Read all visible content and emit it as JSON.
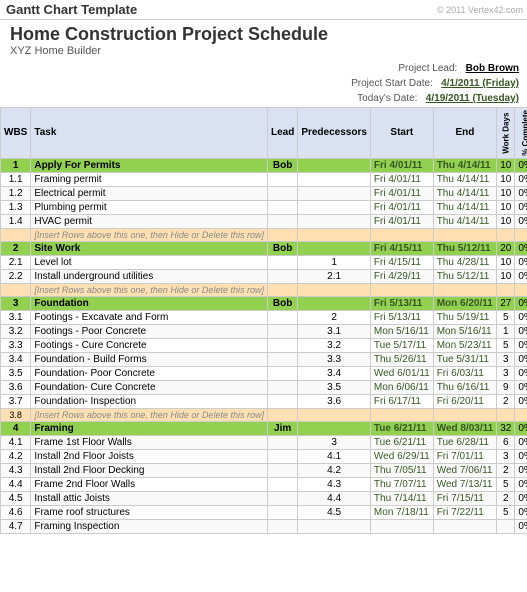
{
  "app": {
    "title": "Gantt Chart Template",
    "copyright": "© 2011 Vertex42.com",
    "project_title": "Home Construction Project Schedule",
    "subtitle": "XYZ Home Builder"
  },
  "project_info": {
    "lead_label": "Project Lead:",
    "lead_value": "Bob Brown",
    "start_label": "Project Start Date:",
    "start_value": "4/1/2011 (Friday)",
    "today_label": "Today's Date:",
    "today_value": "4/19/2011 (Tuesday)"
  },
  "table": {
    "headers": [
      "WBS",
      "Task",
      "Lead",
      "Predecessors",
      "Start",
      "End",
      "Work Days",
      "% Complete"
    ],
    "rows": [
      {
        "type": "section",
        "wbs": "1",
        "task": "Apply For Permits",
        "lead": "Bob",
        "pred": "",
        "start": "Fri 4/01/11",
        "end": "Thu 4/14/11",
        "wd": "10",
        "pct": "0%"
      },
      {
        "type": "normal",
        "wbs": "1.1",
        "task": "Framing permit",
        "lead": "",
        "pred": "",
        "start": "Fri 4/01/11",
        "end": "Thu 4/14/11",
        "wd": "10",
        "pct": "0%"
      },
      {
        "type": "normal",
        "wbs": "1.2",
        "task": "Electrical permit",
        "lead": "",
        "pred": "",
        "start": "Fri 4/01/11",
        "end": "Thu 4/14/11",
        "wd": "10",
        "pct": "0%"
      },
      {
        "type": "normal",
        "wbs": "1.3",
        "task": "Plumbing permit",
        "lead": "",
        "pred": "",
        "start": "Fri 4/01/11",
        "end": "Thu 4/14/11",
        "wd": "10",
        "pct": "0%"
      },
      {
        "type": "normal",
        "wbs": "1.4",
        "task": "HVAC permit",
        "lead": "",
        "pred": "",
        "start": "Fri 4/01/11",
        "end": "Thu 4/14/11",
        "wd": "10",
        "pct": "0%"
      },
      {
        "type": "insert",
        "wbs": "",
        "task": "[Insert Rows above this one, then Hide or Delete this row]",
        "lead": "",
        "pred": "",
        "start": "",
        "end": "",
        "wd": "",
        "pct": ""
      },
      {
        "type": "section",
        "wbs": "2",
        "task": "Site Work",
        "lead": "Bob",
        "pred": "",
        "start": "Fri 4/15/11",
        "end": "Thu 5/12/11",
        "wd": "20",
        "pct": "0%"
      },
      {
        "type": "normal",
        "wbs": "2.1",
        "task": "Level lot",
        "lead": "",
        "pred": "1",
        "start": "Fri 4/15/11",
        "end": "Thu 4/28/11",
        "wd": "10",
        "pct": "0%"
      },
      {
        "type": "normal",
        "wbs": "2.2",
        "task": "Install underground utilities",
        "lead": "",
        "pred": "2.1",
        "start": "Fri 4/29/11",
        "end": "Thu 5/12/11",
        "wd": "10",
        "pct": "0%"
      },
      {
        "type": "insert",
        "wbs": "",
        "task": "[Insert Rows above this one, then Hide or Delete this row]",
        "lead": "",
        "pred": "",
        "start": "",
        "end": "",
        "wd": "",
        "pct": ""
      },
      {
        "type": "section",
        "wbs": "3",
        "task": "Foundation",
        "lead": "Bob",
        "pred": "",
        "start": "Fri 5/13/11",
        "end": "Mon 6/20/11",
        "wd": "27",
        "pct": "0%"
      },
      {
        "type": "normal",
        "wbs": "3.1",
        "task": "Footings - Excavate and Form",
        "lead": "",
        "pred": "2",
        "start": "Fri 5/13/11",
        "end": "Thu 5/19/11",
        "wd": "5",
        "pct": "0%"
      },
      {
        "type": "normal",
        "wbs": "3.2",
        "task": "Footings - Poor Concrete",
        "lead": "",
        "pred": "3.1",
        "start": "Mon 5/16/11",
        "end": "Mon 5/16/11",
        "wd": "1",
        "pct": "0%"
      },
      {
        "type": "normal",
        "wbs": "3.3",
        "task": "Footings - Cure Concrete",
        "lead": "",
        "pred": "3.2",
        "start": "Tue 5/17/11",
        "end": "Mon 5/23/11",
        "wd": "5",
        "pct": "0%"
      },
      {
        "type": "normal",
        "wbs": "3.4",
        "task": "Foundation - Build Forms",
        "lead": "",
        "pred": "3.3",
        "start": "Thu 5/26/11",
        "end": "Tue 5/31/11",
        "wd": "3",
        "pct": "0%"
      },
      {
        "type": "normal",
        "wbs": "3.5",
        "task": "Foundation- Poor Concrete",
        "lead": "",
        "pred": "3.4",
        "start": "Wed 6/01/11",
        "end": "Fri 6/03/11",
        "wd": "3",
        "pct": "0%"
      },
      {
        "type": "normal",
        "wbs": "3.6",
        "task": "Foundation- Cure Concrete",
        "lead": "",
        "pred": "3.5",
        "start": "Mon 6/06/11",
        "end": "Thu 6/16/11",
        "wd": "9",
        "pct": "0%"
      },
      {
        "type": "normal",
        "wbs": "3.7",
        "task": "Foundation- Inspection",
        "lead": "",
        "pred": "3.6",
        "start": "Fri 6/17/11",
        "end": "Fri 6/20/11",
        "wd": "2",
        "pct": "0%"
      },
      {
        "type": "normal",
        "wbs": "3.8",
        "task": "[Insert Rows above this one, then Hide or Delete this row]",
        "lead": "",
        "pred": "",
        "start": "",
        "end": "",
        "wd": "",
        "pct": ""
      },
      {
        "type": "section",
        "wbs": "4",
        "task": "Framing",
        "lead": "Jim",
        "pred": "",
        "start": "Tue 6/21/11",
        "end": "Wed 8/03/11",
        "wd": "32",
        "pct": "0%"
      },
      {
        "type": "normal",
        "wbs": "4.1",
        "task": "Frame 1st Floor Walls",
        "lead": "",
        "pred": "3",
        "start": "Tue 6/21/11",
        "end": "Tue 6/28/11",
        "wd": "6",
        "pct": "0%"
      },
      {
        "type": "normal",
        "wbs": "4.2",
        "task": "Install 2nd Floor Joists",
        "lead": "",
        "pred": "4.1",
        "start": "Wed 6/29/11",
        "end": "Fri 7/01/11",
        "wd": "3",
        "pct": "0%"
      },
      {
        "type": "normal",
        "wbs": "4.3",
        "task": "Install 2nd Floor Decking",
        "lead": "",
        "pred": "4.2",
        "start": "Thu 7/05/11",
        "end": "Wed 7/06/11",
        "wd": "2",
        "pct": "0%"
      },
      {
        "type": "normal",
        "wbs": "4.4",
        "task": "Frame 2nd Floor Walls",
        "lead": "",
        "pred": "4.3",
        "start": "Thu 7/07/11",
        "end": "Wed 7/13/11",
        "wd": "5",
        "pct": "0%"
      },
      {
        "type": "normal",
        "wbs": "4.5",
        "task": "Install attic Joists",
        "lead": "",
        "pred": "4.4",
        "start": "Thu 7/14/11",
        "end": "Fri 7/15/11",
        "wd": "2",
        "pct": "0%"
      },
      {
        "type": "normal",
        "wbs": "4.6",
        "task": "Frame roof structures",
        "lead": "",
        "pred": "4.5",
        "start": "Mon 7/18/11",
        "end": "Fri 7/22/11",
        "wd": "5",
        "pct": "0%"
      },
      {
        "type": "normal",
        "wbs": "4.7",
        "task": "Framing Inspection",
        "lead": "",
        "pred": "",
        "start": "",
        "end": "",
        "wd": "",
        "pct": "0%"
      }
    ]
  }
}
